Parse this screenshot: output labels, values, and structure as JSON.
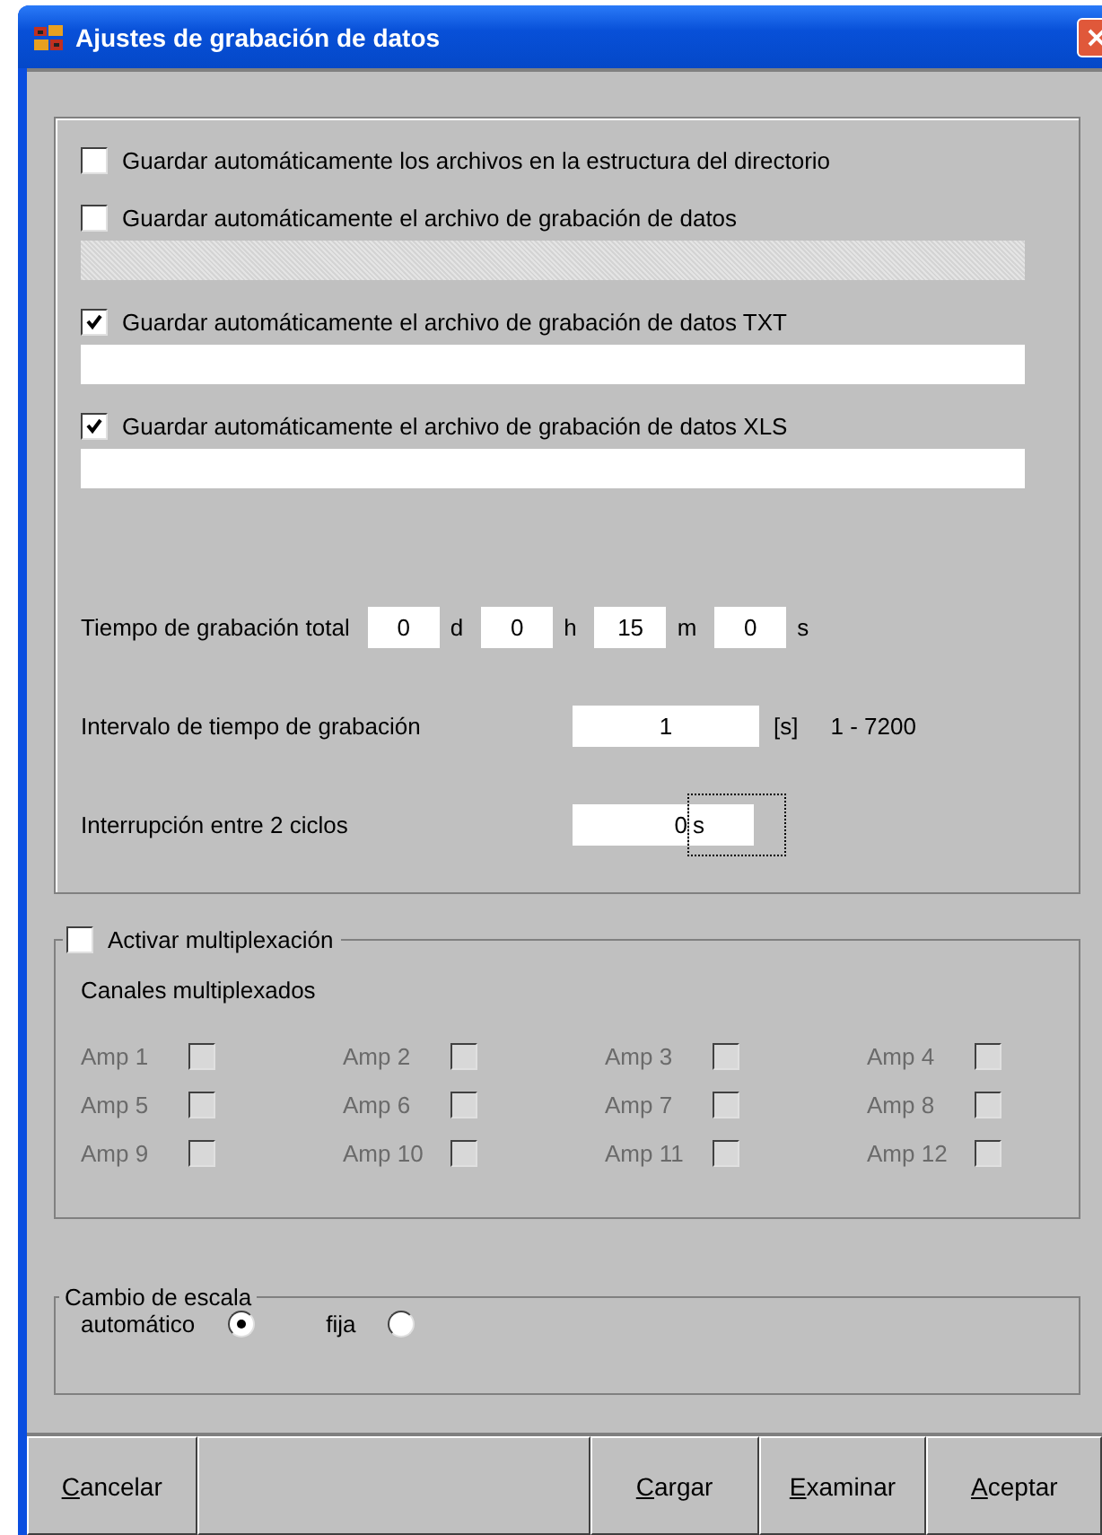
{
  "window": {
    "title": "Ajustes de grabación de datos"
  },
  "save_options": [
    {
      "label": "Guardar automáticamente los archivos en la estructura del directorio",
      "checked": false
    },
    {
      "label": "Guardar automáticamente el archivo de grabación de datos",
      "checked": false,
      "path_field": {
        "disabled": true
      }
    },
    {
      "label": "Guardar automáticamente el archivo de grabación de datos TXT",
      "checked": true,
      "path_field": {
        "disabled": false
      }
    },
    {
      "label": "Guardar automáticamente el archivo de grabación de datos XLS",
      "checked": true,
      "path_field": {
        "disabled": false
      }
    }
  ],
  "total_time": {
    "label": "Tiempo de grabación total",
    "parts": [
      {
        "value": "0",
        "unit": "d"
      },
      {
        "value": "0",
        "unit": "h"
      },
      {
        "value": "15",
        "unit": "m"
      },
      {
        "value": "0",
        "unit": "s"
      }
    ]
  },
  "interval": {
    "label": "Intervalo de tiempo de grabación",
    "value": "1",
    "unit": "[s]",
    "range": "1 -  7200"
  },
  "pause": {
    "label": "Interrupción entre 2 ciclos",
    "value": "0",
    "unit": "s"
  },
  "multiplexing": {
    "label": "Activar multiplexación",
    "checked": false,
    "subtitle": "Canales multiplexados",
    "channels": [
      {
        "label": "Amp 1",
        "checked": false,
        "disabled": true
      },
      {
        "label": "Amp 2",
        "checked": false,
        "disabled": true
      },
      {
        "label": "Amp 3",
        "checked": false,
        "disabled": true
      },
      {
        "label": "Amp 4",
        "checked": false,
        "disabled": true
      },
      {
        "label": "Amp 5",
        "checked": false,
        "disabled": true
      },
      {
        "label": "Amp 6",
        "checked": false,
        "disabled": true
      },
      {
        "label": "Amp 7",
        "checked": false,
        "disabled": true
      },
      {
        "label": "Amp 8",
        "checked": false,
        "disabled": true
      },
      {
        "label": "Amp 9",
        "checked": false,
        "disabled": true
      },
      {
        "label": "Amp 10",
        "checked": false,
        "disabled": true
      },
      {
        "label": "Amp 11",
        "checked": false,
        "disabled": true
      },
      {
        "label": "Amp 12",
        "checked": false,
        "disabled": true
      }
    ]
  },
  "scale": {
    "title": "Cambio de escala",
    "options": [
      {
        "label": "automático",
        "selected": true
      },
      {
        "label": "fija",
        "selected": false
      }
    ]
  },
  "buttons": [
    {
      "kind": "text",
      "label": "Cancelar"
    },
    {
      "kind": "blank"
    },
    {
      "kind": "text",
      "label": "Cargar"
    },
    {
      "kind": "text",
      "label": "Examinar"
    },
    {
      "kind": "text",
      "label": "Aceptar"
    }
  ]
}
